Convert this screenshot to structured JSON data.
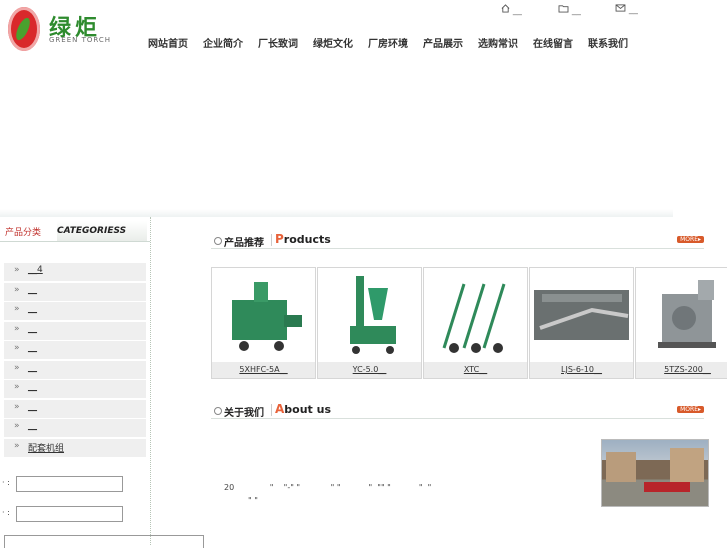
{
  "brand": {
    "name_cn": "绿炬",
    "name_en": "GREEN TORCH"
  },
  "top_links": [
    {
      "icon": "home-icon",
      "label": "__"
    },
    {
      "icon": "folder-icon",
      "label": "__"
    },
    {
      "icon": "mail-icon",
      "label": "__"
    }
  ],
  "nav": [
    "网站首页",
    "企业简介",
    "厂长致词",
    "绿炬文化",
    "厂房环境",
    "产品展示",
    "选购常识",
    "在线留言",
    "联系我们"
  ],
  "sidebar": {
    "title_cn": "产品分类",
    "title_en": "CATEGORIESS",
    "items": [
      "__4",
      "__",
      "__",
      "__",
      "__",
      "__",
      "__",
      "__",
      "__",
      "配套机组"
    ]
  },
  "form": {
    "label1": "·  :",
    "label2": "·  :"
  },
  "products_section": {
    "title_cn": "产品推荐",
    "title_en_initial": "P",
    "title_en_rest": "roducts",
    "more": "MORE▸"
  },
  "products": [
    {
      "name": "5XHFC-5A__",
      "color": "#2f8a5a"
    },
    {
      "name": "YC-5.0__",
      "color": "#2f8a5a"
    },
    {
      "name": "XTC__",
      "color": "#2f8a5a"
    },
    {
      "name": "LJS-6-10__",
      "color": "#6a7070"
    },
    {
      "name": "5TZS-200__",
      "color": "#8f9598"
    }
  ],
  "about_section": {
    "title_cn": "关于我们",
    "title_en_initial": "A",
    "title_en_rest": "bout us",
    "more": "MORE▸"
  },
  "about": {
    "line1": "20              \"    \"-\" \"            \" \"           \"  \"\" \"           \"  \"",
    "line2": "\" \""
  }
}
